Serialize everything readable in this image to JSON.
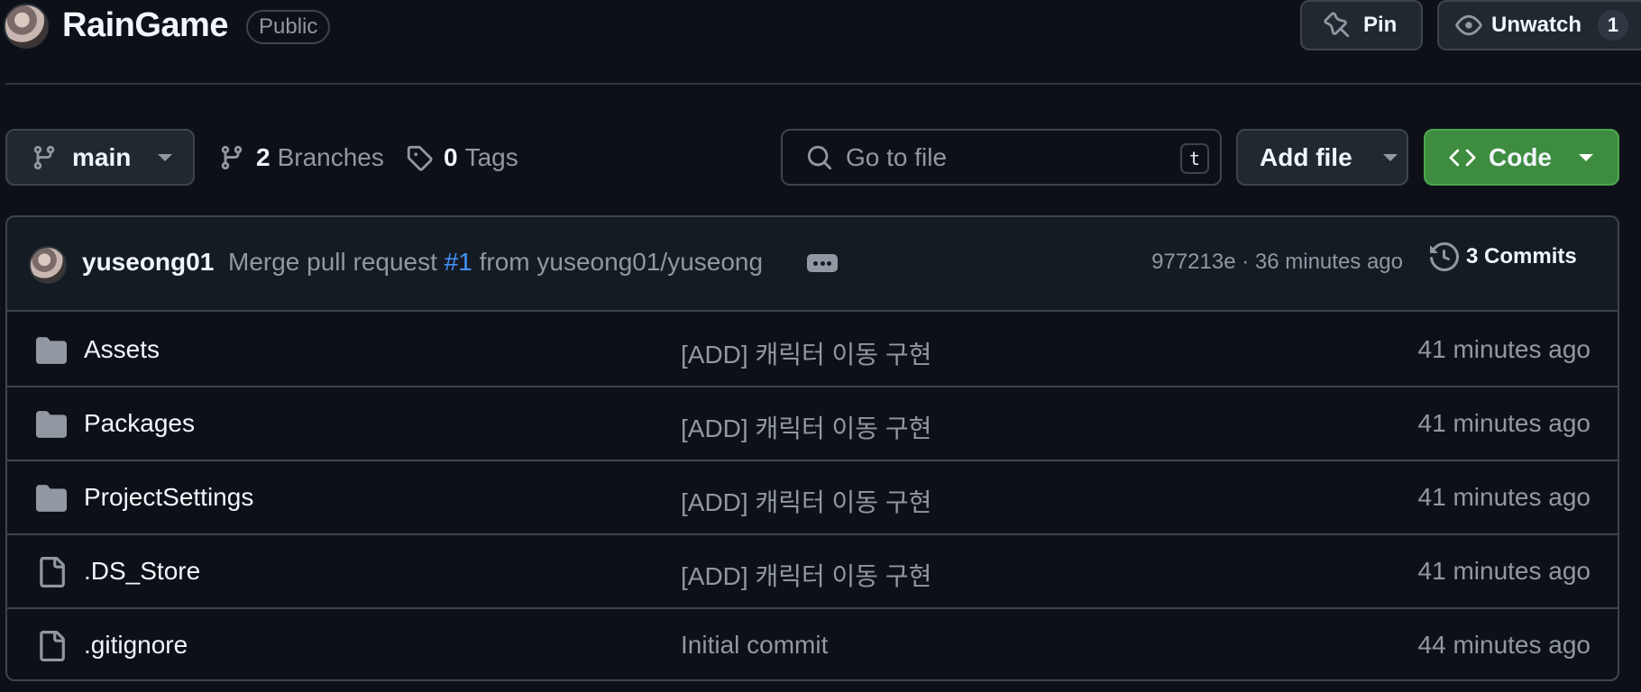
{
  "repo": {
    "name": "RainGame",
    "visibility": "Public"
  },
  "header_actions": {
    "pin_label": "Pin",
    "unwatch_label": "Unwatch",
    "watch_count": "1"
  },
  "toolbar": {
    "branch": "main",
    "branches_count": "2",
    "branches_label": "Branches",
    "tags_count": "0",
    "tags_label": "Tags",
    "search_placeholder": "Go to file",
    "search_shortcut": "t",
    "add_file_label": "Add file",
    "code_label": "Code"
  },
  "latest_commit": {
    "author": "yuseong01",
    "message_prefix": "Merge pull request",
    "pr_link": "#1",
    "message_suffix": "from yuseong01/yuseong",
    "sha_and_time": "977213e · 36 minutes ago",
    "commits_label": "3 Commits"
  },
  "files": [
    {
      "type": "folder",
      "name": "Assets",
      "message": "[ADD] 캐릭터 이동 구현",
      "time": "41 minutes ago"
    },
    {
      "type": "folder",
      "name": "Packages",
      "message": "[ADD] 캐릭터 이동 구현",
      "time": "41 minutes ago"
    },
    {
      "type": "folder",
      "name": "ProjectSettings",
      "message": "[ADD] 캐릭터 이동 구현",
      "time": "41 minutes ago"
    },
    {
      "type": "file",
      "name": ".DS_Store",
      "message": "[ADD] 캐릭터 이동 구현",
      "time": "41 minutes ago"
    },
    {
      "type": "file",
      "name": ".gitignore",
      "message": "Initial commit",
      "time": "44 minutes ago"
    }
  ],
  "colors": {
    "background": "#0d1117",
    "code_button": "#3e8c40",
    "link": "#4493f8",
    "muted_text": "#9198a1"
  }
}
